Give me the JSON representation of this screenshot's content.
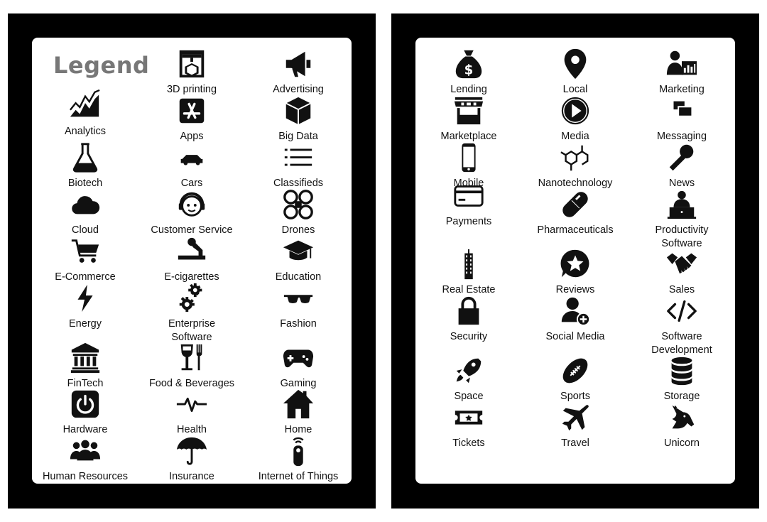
{
  "colors": {
    "frame": "#000000",
    "card": "#ffffff",
    "icon": "#111111",
    "legend_title": "#777777"
  },
  "legend_title": "Legend",
  "left_panel": {
    "items": [
      {
        "label": "3D printing",
        "icon": "3d-printer-icon"
      },
      {
        "label": "Advertising",
        "icon": "megaphone-icon"
      },
      {
        "label": "Analytics",
        "icon": "analytics-chart-icon"
      },
      {
        "label": "Apps",
        "icon": "app-store-icon"
      },
      {
        "label": "Big Data",
        "icon": "cube-icon"
      },
      {
        "label": "Biotech",
        "icon": "flask-icon"
      },
      {
        "label": "Cars",
        "icon": "car-icon"
      },
      {
        "label": "Classifieds",
        "icon": "list-icon"
      },
      {
        "label": "Cloud",
        "icon": "cloud-icon"
      },
      {
        "label": "Customer Service",
        "icon": "headset-agent-icon"
      },
      {
        "label": "Drones",
        "icon": "drone-icon"
      },
      {
        "label": "E-Commerce",
        "icon": "shopping-cart-icon"
      },
      {
        "label": "E-cigarettes",
        "icon": "e-cigarette-icon"
      },
      {
        "label": "Education",
        "icon": "graduation-cap-icon"
      },
      {
        "label": "Energy",
        "icon": "lightning-bolt-icon"
      },
      {
        "label": "Enterprise\nSoftware",
        "icon": "gears-icon"
      },
      {
        "label": "Fashion",
        "icon": "sunglasses-icon"
      },
      {
        "label": "FinTech",
        "icon": "bank-building-icon"
      },
      {
        "label": "Food & Beverages",
        "icon": "glass-fork-icon"
      },
      {
        "label": "Gaming",
        "icon": "gamepad-icon"
      },
      {
        "label": "Hardware",
        "icon": "power-button-icon"
      },
      {
        "label": "Health",
        "icon": "heartbeat-icon"
      },
      {
        "label": "Home",
        "icon": "house-icon"
      },
      {
        "label": "Human Resources",
        "icon": "people-group-icon"
      },
      {
        "label": "Insurance",
        "icon": "umbrella-icon"
      },
      {
        "label": "Internet of Things",
        "icon": "remote-wifi-icon"
      }
    ]
  },
  "right_panel": {
    "items": [
      {
        "label": "Lending",
        "icon": "money-bag-icon"
      },
      {
        "label": "Local",
        "icon": "map-pin-icon"
      },
      {
        "label": "Marketing",
        "icon": "presenter-chart-icon"
      },
      {
        "label": "Marketplace",
        "icon": "market-stall-icon"
      },
      {
        "label": "Media",
        "icon": "play-button-icon"
      },
      {
        "label": "Messaging",
        "icon": "chat-bubbles-icon"
      },
      {
        "label": "Mobile",
        "icon": "smartphone-icon"
      },
      {
        "label": "Nanotechnology",
        "icon": "molecule-icon"
      },
      {
        "label": "News",
        "icon": "microphone-icon"
      },
      {
        "label": "Payments",
        "icon": "credit-card-icon"
      },
      {
        "label": "Pharmaceuticals",
        "icon": "pill-capsule-icon"
      },
      {
        "label": "Productivity\nSoftware",
        "icon": "person-laptop-icon"
      },
      {
        "label": "Real Estate",
        "icon": "skyscraper-icon"
      },
      {
        "label": "Reviews",
        "icon": "star-bubble-icon"
      },
      {
        "label": "Sales",
        "icon": "handshake-icon"
      },
      {
        "label": "Security",
        "icon": "padlock-icon"
      },
      {
        "label": "Social Media",
        "icon": "add-user-icon"
      },
      {
        "label": "Software\nDevelopment",
        "icon": "code-brackets-icon"
      },
      {
        "label": "Space",
        "icon": "rocket-icon"
      },
      {
        "label": "Sports",
        "icon": "football-icon"
      },
      {
        "label": "Storage",
        "icon": "database-icon"
      },
      {
        "label": "Tickets",
        "icon": "ticket-icon"
      },
      {
        "label": "Travel",
        "icon": "airplane-icon"
      },
      {
        "label": "Unicorn",
        "icon": "unicorn-icon"
      }
    ]
  }
}
